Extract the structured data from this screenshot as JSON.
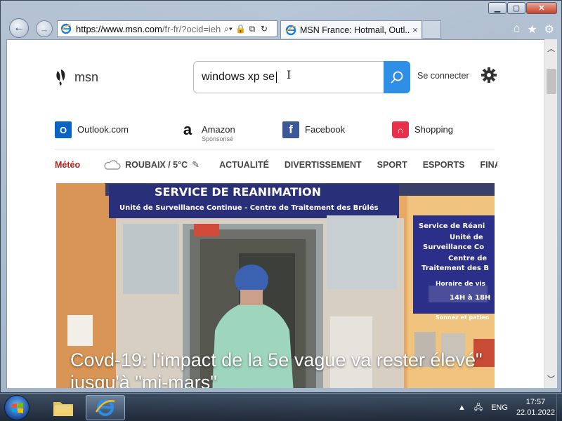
{
  "browser": {
    "url_domain": "https://www.msn.com",
    "url_rest": "/fr-fr/?ocid=ieh",
    "tab_title": "MSN France: Hotmail, Outl...",
    "tab_close": "×"
  },
  "page": {
    "logo_text": "msn",
    "search_value": "windows xp se",
    "signin_label": "Se connecter",
    "quicklinks": [
      {
        "label": "Outlook.com",
        "sub": "",
        "icon": "outlook-icon",
        "color": "#0a64c4"
      },
      {
        "label": "Amazon",
        "sub": "Sponsorisé",
        "icon": "amazon-icon",
        "color": "#111111"
      },
      {
        "label": "Facebook",
        "sub": "",
        "icon": "facebook-icon",
        "color": "#3b5998"
      },
      {
        "label": "Shopping",
        "sub": "",
        "icon": "shopping-bag-icon",
        "color": "#e8304a"
      }
    ],
    "nav": {
      "meteo": "Météo",
      "weather": "ROUBAIX / 5°C",
      "items": [
        "ACTUALITÉ",
        "DIVERTISSEMENT",
        "SPORT",
        "ESPORTS",
        "FINANCE"
      ]
    },
    "hero": {
      "caption": "Covd-19: l'impact de la 5e vague va rester élevé\" jusqu'à \"mi-mars\"",
      "sign_main": "SERVICE DE REANIMATION",
      "sign_sub": "Unité de Surveillance Continue - Centre de Traitement des Brûlés",
      "side_sign_1": "Service de Réani",
      "side_sign_2": "Unité de",
      "side_sign_3": "Surveillance Co",
      "side_sign_4": "Centre de",
      "side_sign_5": "Traitement des B",
      "side_sign_6": "Horaire de vis",
      "side_sign_7": "14H à 18H",
      "side_sign_8": "Sonnez et patien"
    }
  },
  "taskbar": {
    "language": "ENG",
    "time": "17:57",
    "date": "22.01.2022"
  },
  "colors": {
    "accent": "#2f8ee6",
    "meteo_red": "#b0231d"
  }
}
